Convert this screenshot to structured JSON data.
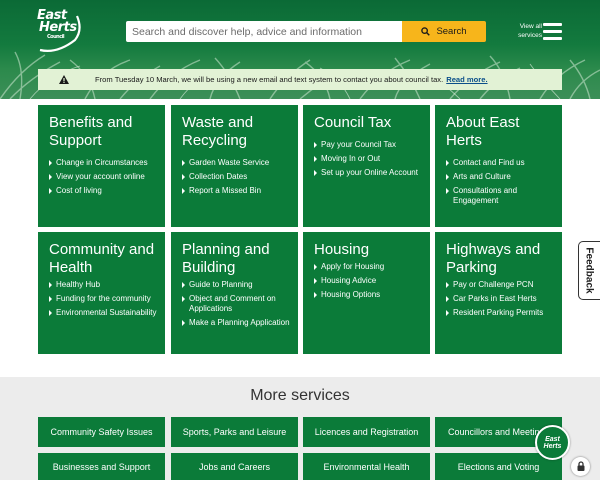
{
  "header": {
    "logo_line1": "East",
    "logo_line2": "Herts",
    "logo_line3": "Council",
    "search_placeholder": "Search and discover help, advice and information",
    "search_button": "Search",
    "view_all_line1": "View all",
    "view_all_line2": "services",
    "menu_icon": "hamburger-icon",
    "search_icon": "search-icon"
  },
  "alert": {
    "icon": "warning-icon",
    "message": "From Tuesday 10 March, we will be using a new email and text system to contact you about council tax.",
    "link": "Read more."
  },
  "tiles": [
    {
      "title": "Benefits and Support",
      "links": [
        "Change in Circumstances",
        "View your account online",
        "Cost of living"
      ]
    },
    {
      "title": "Waste and Recycling",
      "links": [
        "Garden Waste Service",
        "Collection Dates",
        "Report a Missed Bin"
      ]
    },
    {
      "title": "Council Tax",
      "links": [
        "Pay your Council Tax",
        "Moving In or Out",
        "Set up your Online Account"
      ]
    },
    {
      "title": "About East Herts",
      "links": [
        "Contact and Find us",
        "Arts and Culture",
        "Consultations and Engagement"
      ]
    },
    {
      "title": "Community and Health",
      "links": [
        "Healthy Hub",
        "Funding for the community",
        "Environmental Sustainability"
      ]
    },
    {
      "title": "Planning and Building",
      "links": [
        "Guide to Planning",
        "Object and Comment on Applications",
        "Make a Planning Application"
      ]
    },
    {
      "title": "Housing",
      "links": [
        "Apply for Housing",
        "Housing Advice",
        "Housing Options"
      ]
    },
    {
      "title": "Highways and Parking",
      "links": [
        "Pay or Challenge PCN",
        "Car Parks in East Herts",
        "Resident Parking Permits"
      ]
    }
  ],
  "more_services": {
    "title": "More services",
    "items": [
      "Community Safety Issues",
      "Sports, Parks and Leisure",
      "Licences and Registration",
      "Councillors and Meetings",
      "Businesses and Support",
      "Jobs and Careers",
      "Environmental Health",
      "Elections and Voting"
    ]
  },
  "feedback_label": "Feedback",
  "chat_badge": {
    "line1": "East",
    "line2": "Herts"
  },
  "colors": {
    "brand_green": "#0b7b39",
    "search_yellow": "#f7b51b",
    "alert_bg": "#e2f2d5",
    "page_grey": "#ececec"
  }
}
